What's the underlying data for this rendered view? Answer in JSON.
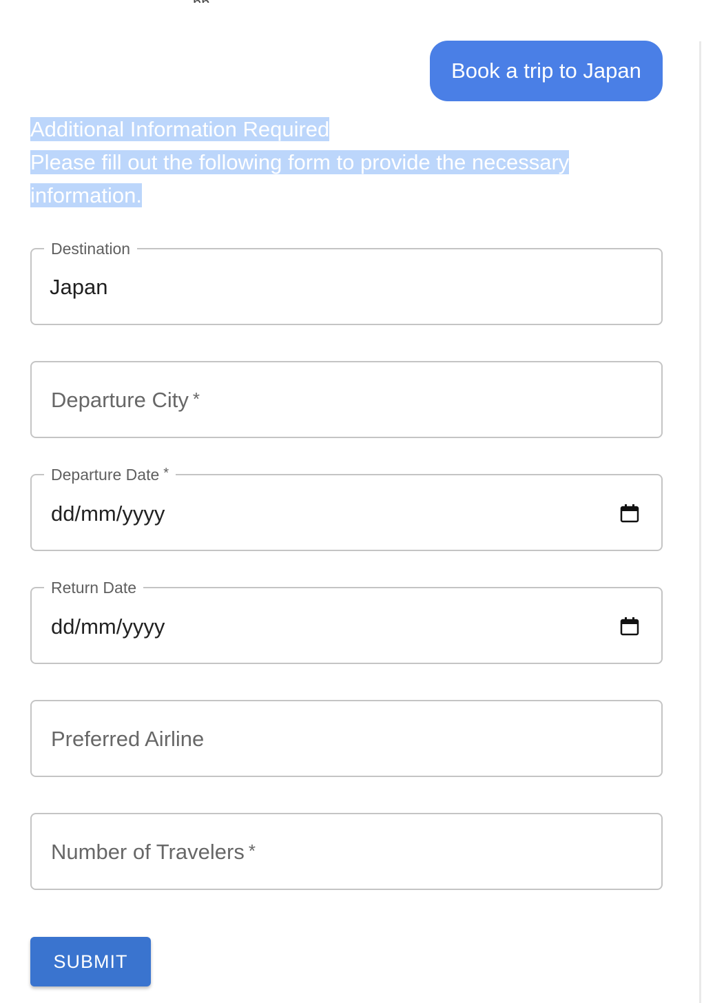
{
  "chat": {
    "user_message": "Book a trip to Japan",
    "assistant_title": "Additional Information Required",
    "assistant_body_line1": "Please fill out the following form to provide the necessary",
    "assistant_body_line2": "information."
  },
  "form": {
    "destination": {
      "label": "Destination",
      "value": "Japan"
    },
    "departure_city": {
      "placeholder": "Departure City",
      "required_mark": "*"
    },
    "departure_date": {
      "label": "Departure Date",
      "required_mark": "*",
      "value": "dd/mm/yyyy",
      "icon": "calendar-icon"
    },
    "return_date": {
      "label": "Return Date",
      "value": "dd/mm/yyyy",
      "icon": "calendar-icon"
    },
    "preferred_airline": {
      "placeholder": "Preferred Airline"
    },
    "number_of_travelers": {
      "placeholder": "Number of Travelers",
      "required_mark": "*"
    },
    "submit_label": "SUBMIT"
  },
  "colors": {
    "accent": "#4a7fe6",
    "button": "#3a74cf",
    "selection_highlight": "#bcd6fb"
  }
}
